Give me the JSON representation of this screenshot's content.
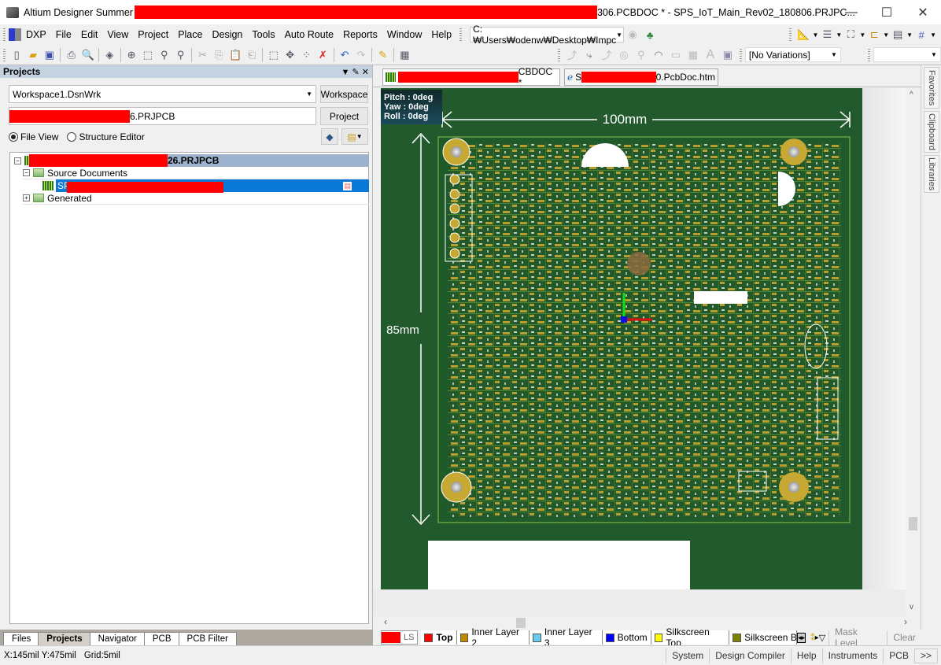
{
  "window": {
    "title_prefix": "Altium Designer Summer",
    "title_suffix": "306.PCBDOC * - SPS_IoT_Main_Rev02_180806.PRJPC...",
    "minimize": "—",
    "maximize": "☐",
    "close": "✕"
  },
  "menubar": {
    "items": [
      "DXP",
      "File",
      "Edit",
      "View",
      "Project",
      "Place",
      "Design",
      "Tools",
      "Auto Route",
      "Reports",
      "Window",
      "Help"
    ],
    "path": "C:₩Users₩odenw₩Desktop₩Impc"
  },
  "toolbar": {
    "variations": "[No Variations]",
    "second_combo": ""
  },
  "projects_panel": {
    "title": "Projects",
    "workspace_value": "Workspace1.DsnWrk",
    "workspace_button": "Workspace",
    "project_value": "6.PRJPCB",
    "project_button": "Project",
    "view_file": "File View",
    "view_structure": "Structure Editor",
    "tree": {
      "project": "26.PRJPCB",
      "source_documents": "Source Documents",
      "doc": "SP",
      "generated": "Generated"
    }
  },
  "panel_tabs": [
    "Files",
    "Projects",
    "Navigator",
    "PCB",
    "PCB Filter"
  ],
  "doc_tabs": [
    {
      "label": "CBDOC *"
    },
    {
      "prefix": "S",
      "label": "0.PcbDoc.htm"
    }
  ],
  "view_overlay": {
    "pitch": "Pitch : 0deg",
    "yaw": "Yaw : 0deg",
    "roll": "Roll : 0deg"
  },
  "pcb": {
    "width_dimension": "100mm",
    "height_dimension": "85mm"
  },
  "right_dock": [
    "Favorites",
    "Clipboard",
    "Libraries"
  ],
  "layer_bar": {
    "ls": "LS",
    "layers": [
      {
        "name": "Top",
        "color": "#ff0000",
        "active": true
      },
      {
        "name": "Inner Layer 2",
        "color": "#c08a00"
      },
      {
        "name": "Inner Layer 3",
        "color": "#66ccee"
      },
      {
        "name": "Bottom",
        "color": "#0000ff"
      },
      {
        "name": "Silkscreen Top",
        "color": "#ffff00"
      },
      {
        "name": "Silkscreen Bott",
        "color": "#808000"
      }
    ],
    "mask_level": "Mask Level",
    "clear": "Clear"
  },
  "status": {
    "coords": "X:145mil Y:475mil",
    "grid": "Grid:5mil",
    "buttons": [
      "System",
      "Design Compiler",
      "Help",
      "Instruments",
      "PCB",
      ">>"
    ]
  }
}
